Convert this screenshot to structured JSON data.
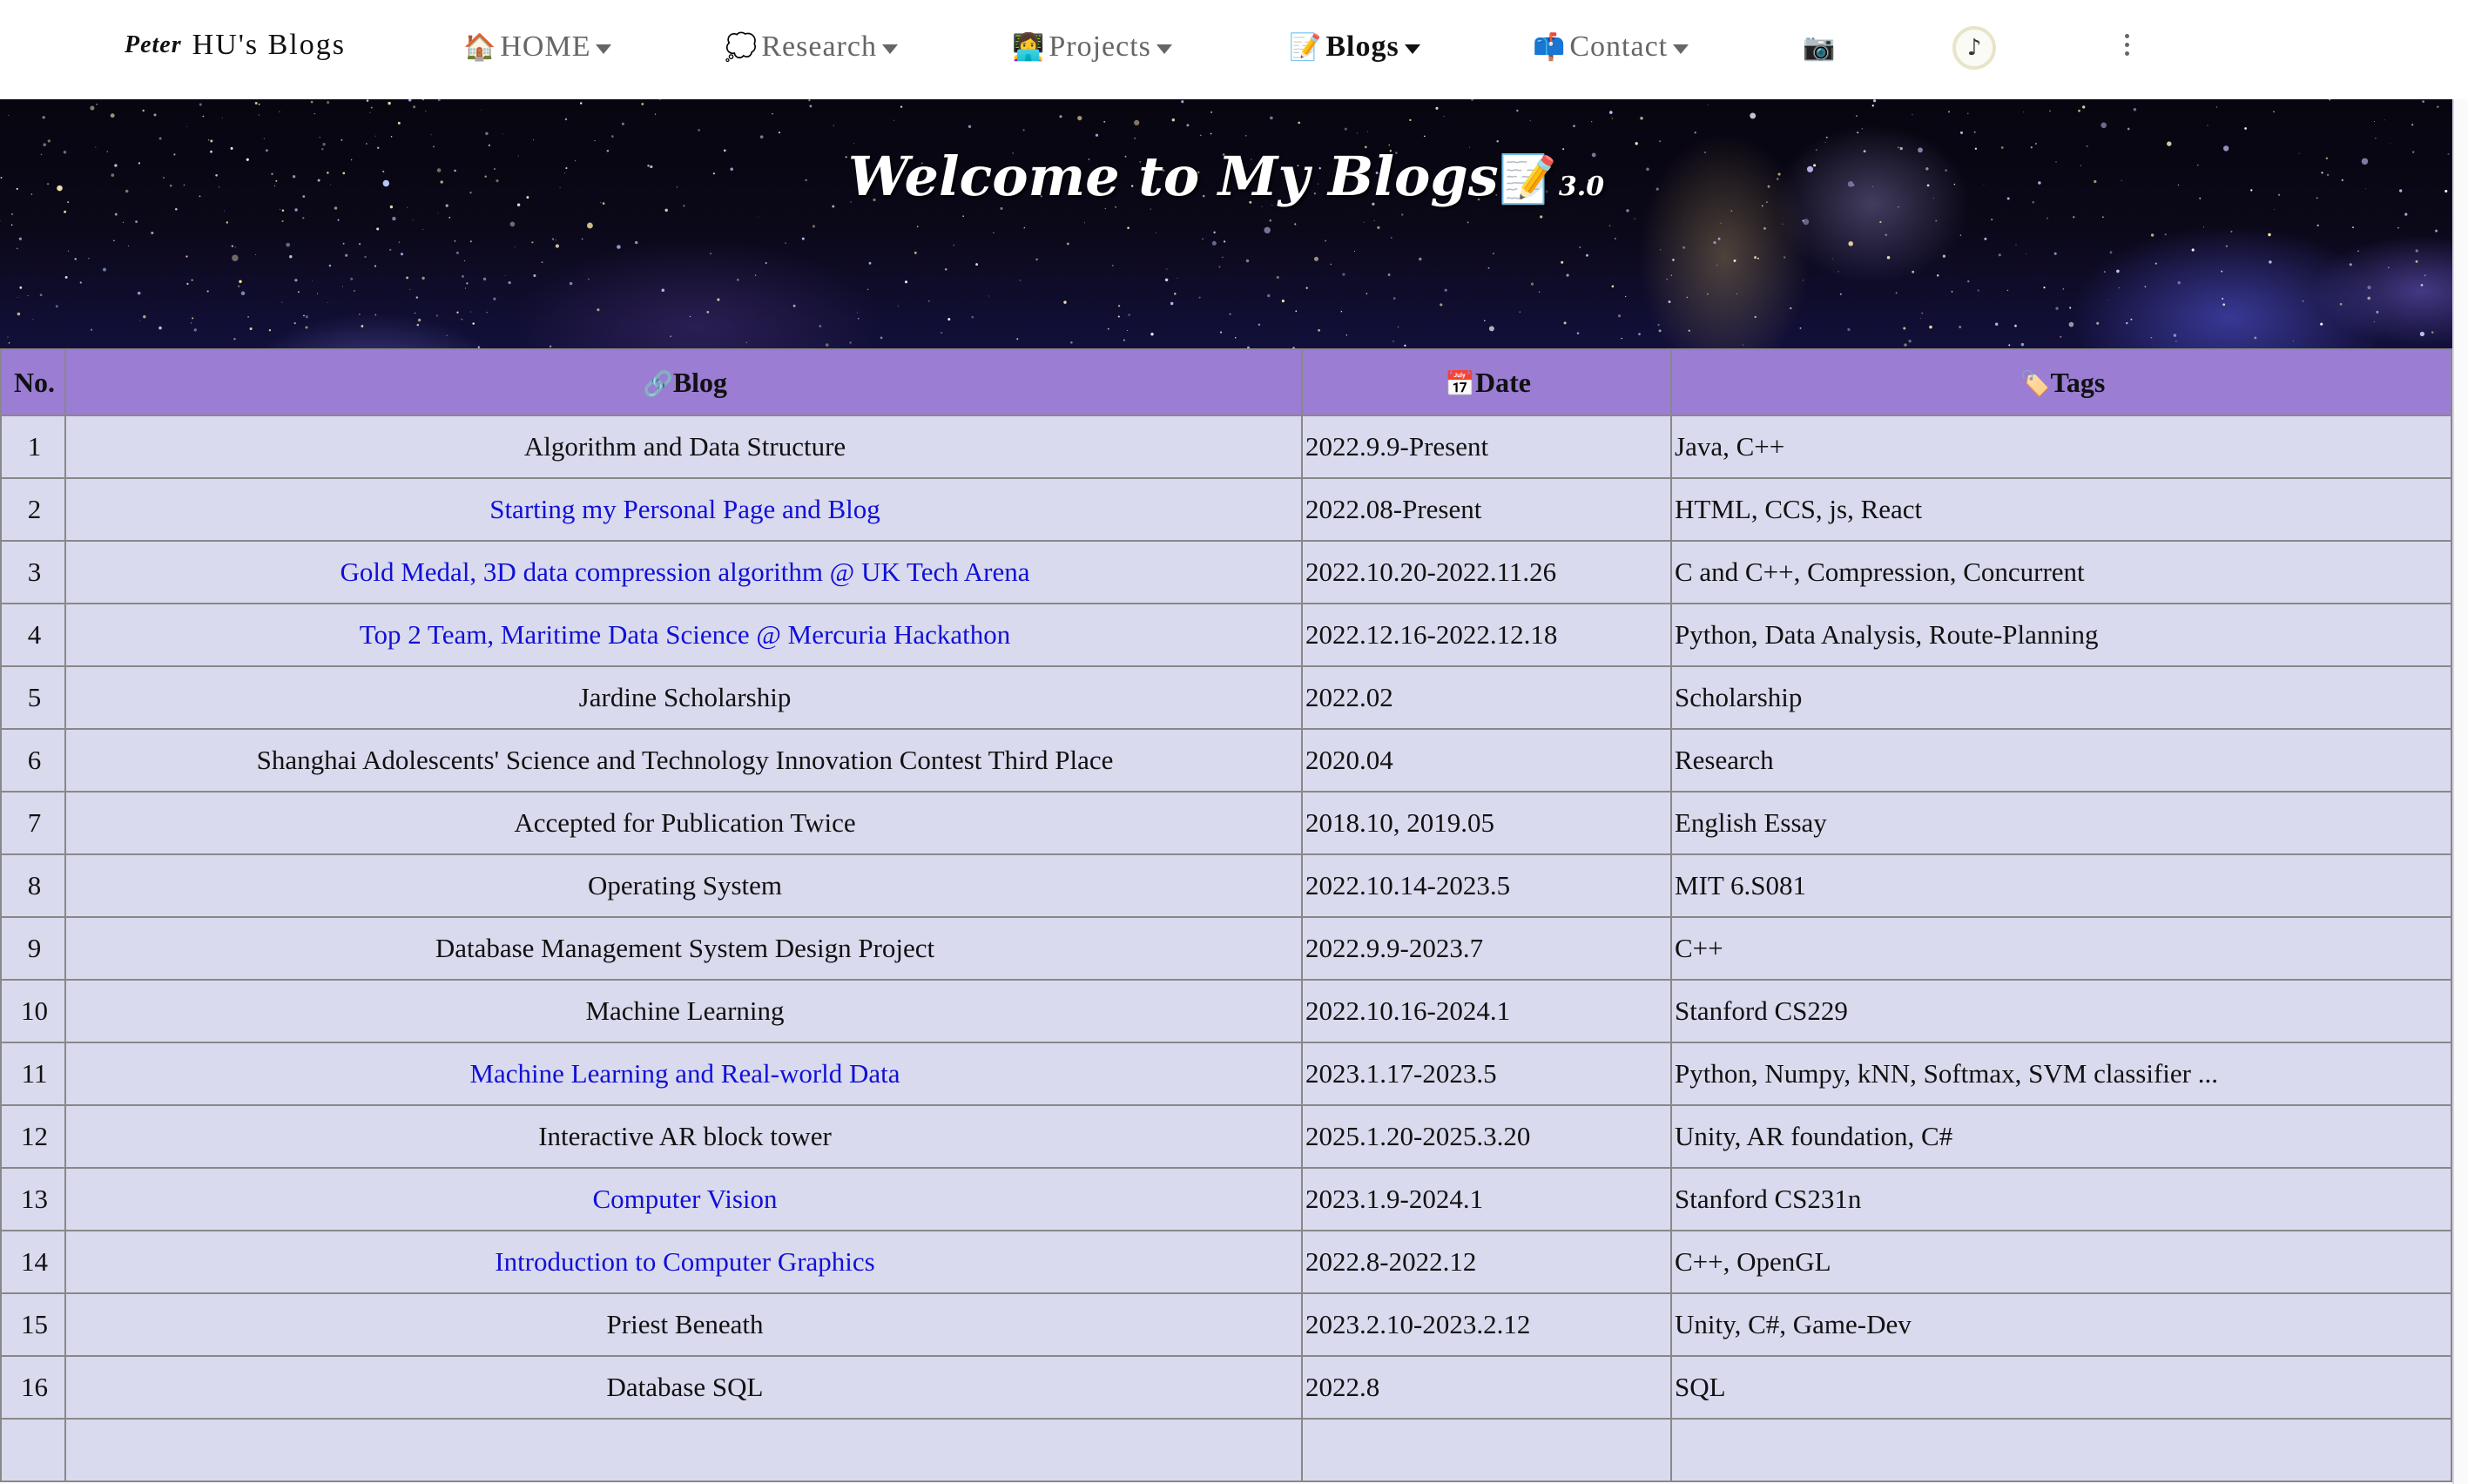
{
  "nav": {
    "brand_script": "Peter",
    "brand_text": "HU's Blogs",
    "items": [
      {
        "emoji": "🏠",
        "label": "HOME"
      },
      {
        "emoji": "💭",
        "label": "Research"
      },
      {
        "emoji": "👩‍💻",
        "label": "Projects"
      },
      {
        "emoji": "📝",
        "label": "Blogs"
      },
      {
        "emoji": "📫",
        "label": "Contact"
      }
    ],
    "camera_icon": "📷",
    "music_icon": "♪"
  },
  "banner": {
    "title": "Welcome to My Blogs",
    "title_emoji": "📝",
    "version": "3.0"
  },
  "table": {
    "headers": {
      "no": "No.",
      "blog_emoji": "🔗",
      "blog": "Blog",
      "date_emoji": "📅",
      "date": "Date",
      "tags_emoji": "🏷️",
      "tags": "Tags"
    },
    "rows": [
      {
        "no": "1",
        "title": "Algorithm and Data Structure",
        "link": false,
        "date": "2022.9.9-Present",
        "tags": "Java, C++"
      },
      {
        "no": "2",
        "title": "Starting my Personal Page and Blog",
        "link": true,
        "date": "2022.08-Present",
        "tags": "HTML, CCS, js, React"
      },
      {
        "no": "3",
        "title": "Gold Medal, 3D data compression algorithm @ UK Tech Arena",
        "link": true,
        "date": "2022.10.20-2022.11.26",
        "tags": "C and C++, Compression, Concurrent"
      },
      {
        "no": "4",
        "title": "Top 2 Team, Maritime Data Science @ Mercuria Hackathon",
        "link": true,
        "date": "2022.12.16-2022.12.18",
        "tags": "Python, Data Analysis, Route-Planning"
      },
      {
        "no": "5",
        "title": "Jardine Scholarship",
        "link": false,
        "date": "2022.02",
        "tags": "Scholarship"
      },
      {
        "no": "6",
        "title": "Shanghai Adolescents' Science and Technology Innovation Contest Third Place",
        "link": false,
        "date": "2020.04",
        "tags": "Research"
      },
      {
        "no": "7",
        "title": "Accepted for Publication Twice",
        "link": false,
        "date": "2018.10, 2019.05",
        "tags": "English Essay"
      },
      {
        "no": "8",
        "title": "Operating System",
        "link": false,
        "date": "2022.10.14-2023.5",
        "tags": "MIT 6.S081"
      },
      {
        "no": "9",
        "title": "Database Management System Design Project",
        "link": false,
        "date": "2022.9.9-2023.7",
        "tags": "C++"
      },
      {
        "no": "10",
        "title": "Machine Learning",
        "link": false,
        "date": "2022.10.16-2024.1",
        "tags": "Stanford CS229"
      },
      {
        "no": "11",
        "title": "Machine Learning and Real-world Data",
        "link": true,
        "date": "2023.1.17-2023.5",
        "tags": "Python, Numpy, kNN, Softmax, SVM classifier ..."
      },
      {
        "no": "12",
        "title": "Interactive AR block tower",
        "link": false,
        "date": "2025.1.20-2025.3.20",
        "tags": "Unity, AR foundation, C#"
      },
      {
        "no": "13",
        "title": "Computer Vision",
        "link": true,
        "date": "2023.1.9-2024.1",
        "tags": "Stanford CS231n"
      },
      {
        "no": "14",
        "title": "Introduction to Computer Graphics",
        "link": true,
        "date": "2022.8-2022.12",
        "tags": "C++, OpenGL"
      },
      {
        "no": "15",
        "title": "Priest Beneath",
        "link": false,
        "date": "2023.2.10-2023.2.12",
        "tags": "Unity, C#, Game-Dev"
      },
      {
        "no": "16",
        "title": "Database SQL",
        "link": false,
        "date": "2022.8",
        "tags": "SQL"
      },
      {
        "no": "",
        "title": "",
        "link": false,
        "date": "",
        "tags": ""
      }
    ]
  },
  "colors": {
    "header_bg": "#9b7dd3",
    "row_bg": "#dadaee",
    "link": "#1010d8"
  }
}
